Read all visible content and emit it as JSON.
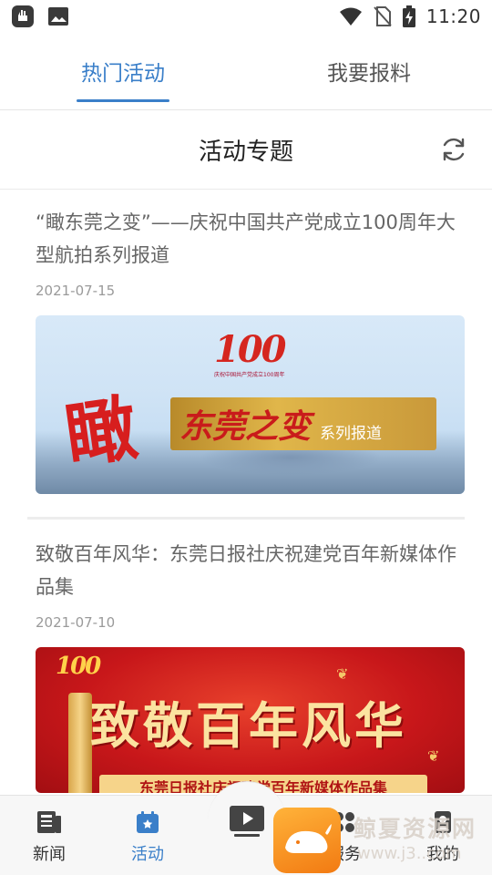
{
  "status_bar": {
    "time": "11:20",
    "left_icons": [
      "app-notification-icon",
      "image-icon"
    ],
    "right_icons": [
      "wifi-icon",
      "no-sim-icon",
      "battery-charging-icon"
    ]
  },
  "tabs": [
    {
      "label": "热门活动",
      "active": true
    },
    {
      "label": "我要报料",
      "active": false
    }
  ],
  "section": {
    "title": "活动专题",
    "refresh_icon": "refresh-icon"
  },
  "articles": [
    {
      "title": "“瞰东莞之变”——庆祝中国共产党成立100周年大型航拍系列报道",
      "date": "2021-07-15",
      "image": {
        "badge": "100",
        "badge_sub": "庆祝中国共产党成立100周年",
        "big_char": "瞰",
        "banner_main": "东莞之变",
        "banner_sub": "系列报道"
      }
    },
    {
      "title": "致敬百年风华：东莞日报社庆祝建党百年新媒体作品集",
      "date": "2021-07-10",
      "image": {
        "badge": "100",
        "main_title": "致敬百年风华",
        "sub_banner": "东莞日报社庆祝建党百年新媒体作品集"
      }
    }
  ],
  "bottom_nav": [
    {
      "label": "新闻",
      "icon": "newspaper-icon",
      "active": false
    },
    {
      "label": "活动",
      "icon": "calendar-star-icon",
      "active": true
    },
    {
      "label": "",
      "icon": "video-play-icon",
      "active": false
    },
    {
      "label": "服务",
      "icon": "grid-icon",
      "active": false
    },
    {
      "label": "我的",
      "icon": "person-icon",
      "active": false
    }
  ],
  "watermark": {
    "text": "鲸夏资源网",
    "url": "www.j3..com"
  },
  "colors": {
    "accent": "#3a7fc9",
    "text_primary": "#222222",
    "text_secondary": "#666666",
    "date": "#9a9a9a"
  }
}
